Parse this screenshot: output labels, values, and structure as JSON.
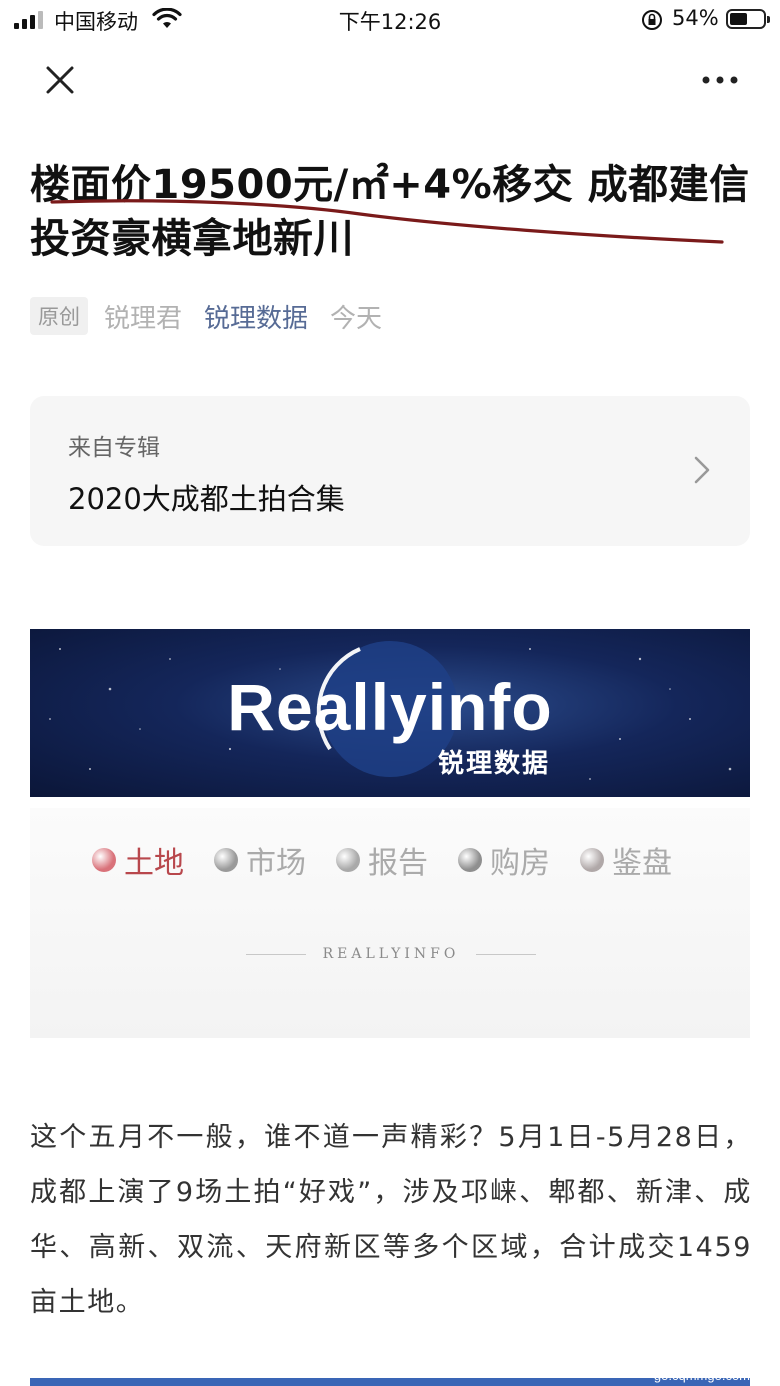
{
  "status_bar": {
    "carrier": "中国移动",
    "time": "下午12:26",
    "battery_percent": "54%",
    "battery_level": 0.54
  },
  "article": {
    "title": "楼面价19500元/㎡+4%移交 成都建信投资豪横拿地新川",
    "original_tag": "原创",
    "author": "锐理君",
    "account": "锐理数据",
    "date": "今天",
    "body": "这个五月不一般，谁不道一声精彩？5月1日-5月28日，成都上演了9场土拍“好戏”，涉及邛崃、郫都、新津、成华、高新、双流、天府新区等多个区域，合计成交1459亩土地。"
  },
  "album": {
    "from_label": "来自专辑",
    "name": "2020大成都土拍合集"
  },
  "banner": {
    "logo_text": "Reallyinfo",
    "subtitle": "锐理数据"
  },
  "nav": {
    "items": [
      {
        "label": "土地",
        "color": "#d9727a",
        "active": true
      },
      {
        "label": "市场",
        "color": "#9a9a9a",
        "active": false
      },
      {
        "label": "报告",
        "color": "#a9a9a9",
        "active": false
      },
      {
        "label": "购房",
        "color": "#8f8f8f",
        "active": false
      },
      {
        "label": "鉴盘",
        "color": "#b0a8a8",
        "active": false
      }
    ],
    "brand": "REALLYINFO"
  },
  "watermark": "go.cqmmgo.com",
  "colors": {
    "account_link": "#576b95",
    "active_tab": "#b8474c",
    "annotation_stroke": "#7a1a1a"
  }
}
